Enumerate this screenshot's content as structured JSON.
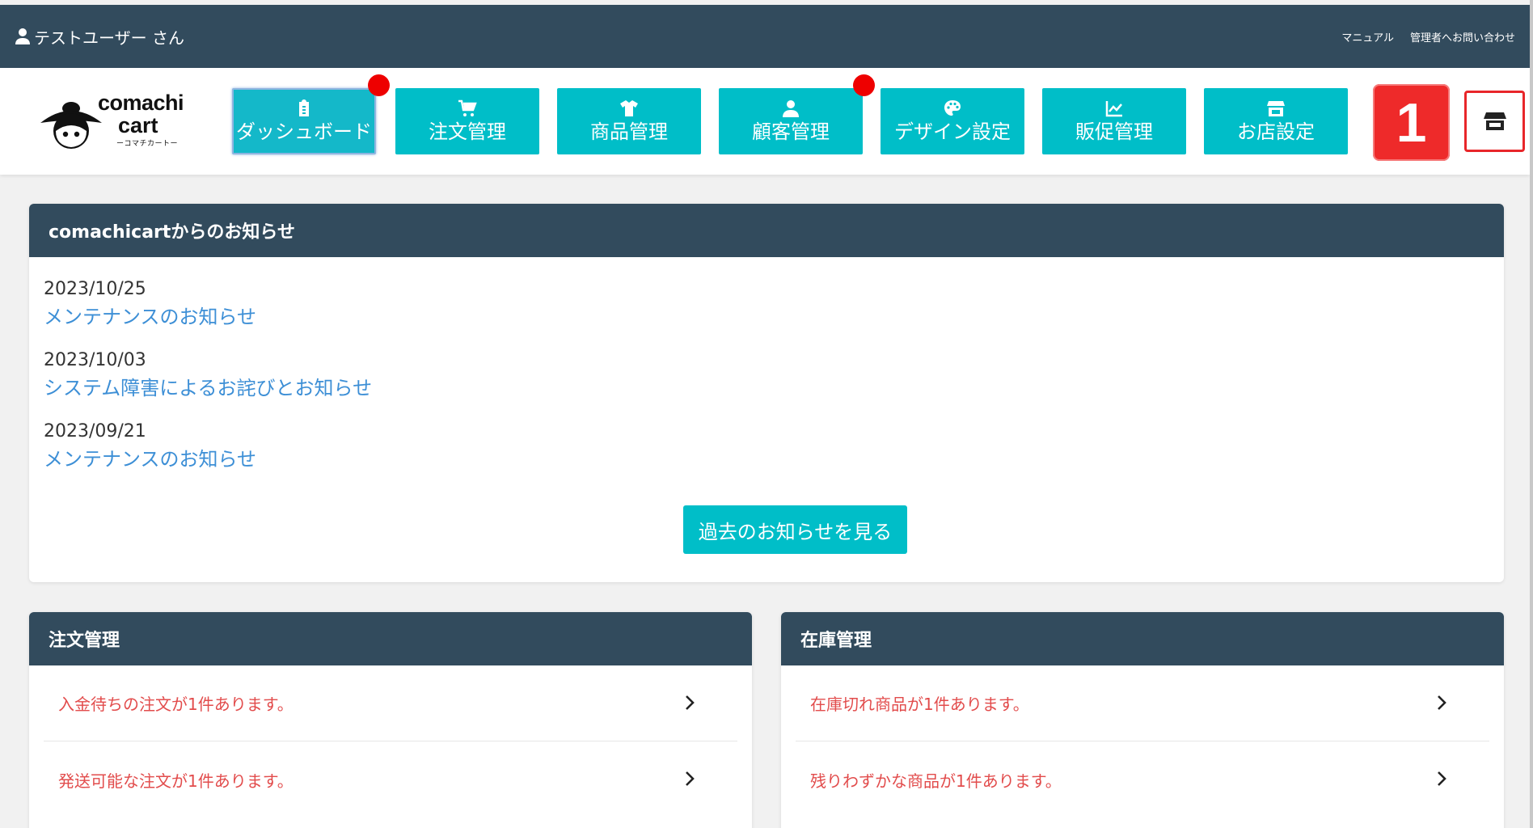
{
  "topbar": {
    "user_label": "テストユーザー さん",
    "links": [
      "マニュアル",
      "管理者へお問い合わせ"
    ]
  },
  "logo": {
    "line1": "comachi",
    "line2": "cart",
    "sub": "ーコマチカートー"
  },
  "nav": {
    "items": [
      {
        "label": "ダッシュボード",
        "icon": "clipboard-icon",
        "active": true,
        "notify": true
      },
      {
        "label": "注文管理",
        "icon": "cart-icon",
        "active": false,
        "notify": false
      },
      {
        "label": "商品管理",
        "icon": "tshirt-icon",
        "active": false,
        "notify": false
      },
      {
        "label": "顧客管理",
        "icon": "user-icon",
        "active": false,
        "notify": true
      },
      {
        "label": "デザイン設定",
        "icon": "palette-icon",
        "active": false,
        "notify": false
      },
      {
        "label": "販促管理",
        "icon": "chart-line-icon",
        "active": false,
        "notify": false
      },
      {
        "label": "お店設定",
        "icon": "store-icon",
        "active": false,
        "notify": false
      }
    ],
    "annotation_number": "1",
    "store_icon": "store-icon",
    "notify_color": "#ee0000",
    "accent_color": "#00bec8"
  },
  "news": {
    "heading": "comachicartからのお知らせ",
    "items": [
      {
        "date": "2023/10/25",
        "title": "メンテナンスのお知らせ"
      },
      {
        "date": "2023/10/03",
        "title": "システム障害によるお詫びとお知らせ"
      },
      {
        "date": "2023/09/21",
        "title": "メンテナンスのお知らせ"
      }
    ],
    "more_label": "過去のお知らせを見る"
  },
  "orders": {
    "heading": "注文管理",
    "rows": [
      "入金待ちの注文が1件あります。",
      "発送可能な注文が1件あります。"
    ]
  },
  "stock": {
    "heading": "在庫管理",
    "rows": [
      "在庫切れ商品が1件あります。",
      "残りわずかな商品が1件あります。"
    ]
  },
  "colors": {
    "header_bg": "#324b5d",
    "alert_text": "#e24c4c",
    "link": "#3d8fd6"
  }
}
